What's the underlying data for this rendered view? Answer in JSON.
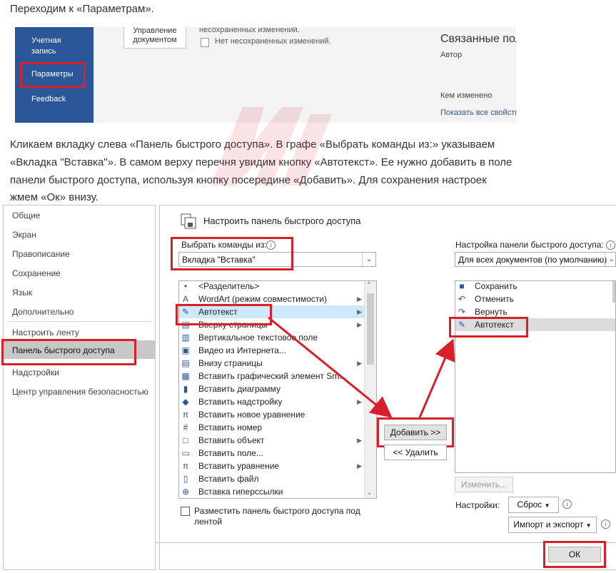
{
  "intro_text": "Переходим к «Параметрам».",
  "file_nav": {
    "items": [
      {
        "label": "Учетная запись"
      },
      {
        "label": "Параметры"
      },
      {
        "label": "Feedback"
      }
    ],
    "manage_doc": "Управление документом",
    "unsaved1": "несохраненных изменений.",
    "unsaved2": "Нет несохраненных изменений.",
    "related": "Связанные поль",
    "author": "Автор",
    "modified_by": "Кем изменено",
    "show_all": "Показать все свойств"
  },
  "paragraph": [
    "Кликаем вкладку слева «Панель быстрого доступа». В графе «Выбрать команды из:» указываем",
    "«Вкладка \"Вставка\"». В самом верху перечня увидим кнопку «Автотекст». Ее нужно добавить в поле",
    "панели быстрого доступа, используя кнопку посередине «Добавить». Для сохранения настроек",
    "жмем «Ок» внизу."
  ],
  "options_nav": [
    "Общие",
    "Экран",
    "Правописание",
    "Сохранение",
    "Язык",
    "Дополнительно",
    "Настроить ленту",
    "Панель быстрого доступа",
    "Надстройки",
    "Центр управления безопасностью"
  ],
  "dialog": {
    "heading": "Настроить панель быстрого доступа",
    "choose_label": "Выбрать команды из:",
    "choose_value": "Вкладка \"Вставка\"",
    "qat_label": "Настройка панели быстрого доступа:",
    "qat_value": "Для всех документов (по умолчанию)",
    "commands": [
      {
        "icon": "separator-icon",
        "label": "<Разделитель>",
        "sub": false
      },
      {
        "icon": "wordart-icon",
        "label": "WordArt (режим совместимости)",
        "sub": true
      },
      {
        "icon": "autotext-icon",
        "label": "Автотекст",
        "sub": true
      },
      {
        "icon": "header-icon",
        "label": "Вверху страницы",
        "sub": true
      },
      {
        "icon": "textbox-icon",
        "label": "Вертикальное текстовое поле",
        "sub": false
      },
      {
        "icon": "video-icon",
        "label": "Видео из Интернета...",
        "sub": false
      },
      {
        "icon": "footer-icon",
        "label": "Внизу страницы",
        "sub": true
      },
      {
        "icon": "smartart-icon",
        "label": "Вставить графический элемент Sm...",
        "sub": false
      },
      {
        "icon": "chart-icon",
        "label": "Вставить диаграмму",
        "sub": false
      },
      {
        "icon": "addin-icon",
        "label": "Вставить надстройку",
        "sub": true
      },
      {
        "icon": "pi-icon",
        "label": "Вставить новое уравнение",
        "sub": false
      },
      {
        "icon": "number-icon",
        "label": "Вставить номер",
        "sub": false
      },
      {
        "icon": "object-icon",
        "label": "Вставить объект",
        "sub": true
      },
      {
        "icon": "field-icon",
        "label": "Вставить поле...",
        "sub": false
      },
      {
        "icon": "pi-icon",
        "label": "Вставить уравнение",
        "sub": true
      },
      {
        "icon": "file-icon",
        "label": "Вставить файл",
        "sub": false
      },
      {
        "icon": "link-icon",
        "label": "Вставка гиперссылки",
        "sub": false
      }
    ],
    "qat_items": [
      {
        "icon": "save-icon",
        "label": "Сохранить"
      },
      {
        "icon": "undo-icon",
        "label": "Отменить"
      },
      {
        "icon": "redo-icon",
        "label": "Вернуть"
      },
      {
        "icon": "autotext-icon",
        "label": "Автотекст"
      }
    ],
    "add_button": "Добавить >>",
    "remove_button": "<< Удалить",
    "qat_checkbox": "Разместить панель быстрого доступа под лентой",
    "modify_button": "Изменить...",
    "settings_label": "Настройки:",
    "reset_button": "Сброс",
    "import_export": "Импорт и экспорт",
    "ok_button": "ОК"
  },
  "colors": {
    "accent": "#2b579a",
    "highlight": "#d9202a",
    "selection": "#cde8ff"
  }
}
